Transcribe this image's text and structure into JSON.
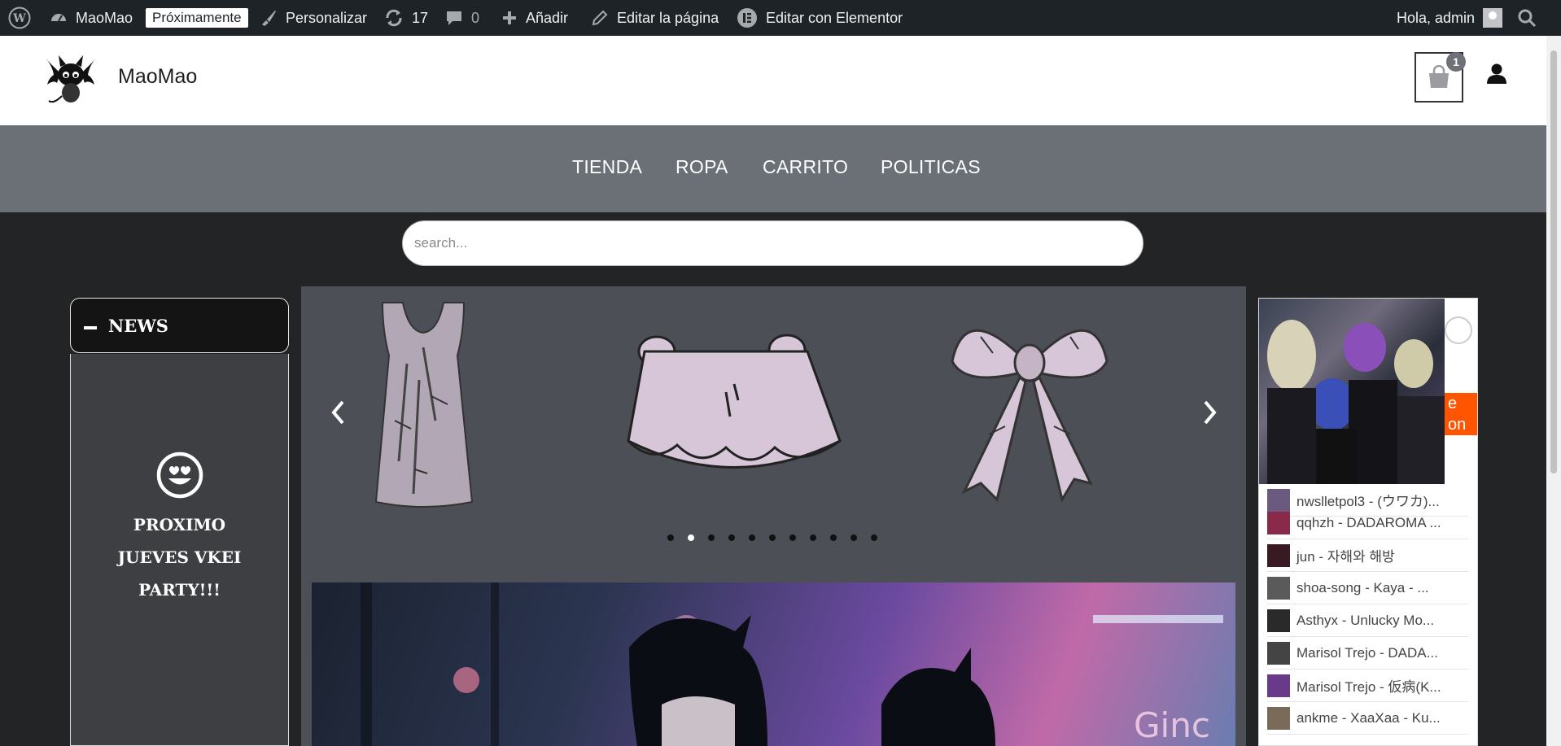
{
  "admin_bar": {
    "site_name": "MaoMao",
    "coming_soon": "Próximamente",
    "customize": "Personalizar",
    "updates_count": "17",
    "comments_count": "0",
    "add_new": "Añadir",
    "edit_page": "Editar la página",
    "edit_elementor": "Editar con Elementor",
    "greeting": "Hola, admin"
  },
  "header": {
    "site_title": "MaoMao",
    "cart_count": "1"
  },
  "nav": {
    "items": [
      "TIENDA",
      "ROPA",
      "CARRITO",
      "POLITICAS"
    ]
  },
  "search": {
    "placeholder": "search..."
  },
  "news": {
    "title": "NEWS",
    "body": "PROXIMO JUEVES VKEI PARTY!!!"
  },
  "carousel": {
    "slide_count": 11,
    "active_index": 1
  },
  "soundcloud": {
    "listen_text": "e on ud",
    "tracks": [
      "nwslletpol3 - (ウワカ)...",
      "qqhzh - DADAROMA ...",
      "jun - 자해와 해방",
      "shoa-song - Kaya - ...",
      "Asthyx - Unlucky Mo...",
      "Marisol Trejo - DADA...",
      "Marisol Trejo - 仮病(K...",
      "ankme - XaaXaa - Ku..."
    ]
  },
  "colors": {
    "admin_bg": "#1d2327",
    "nav_bg": "#6b6f76",
    "page_bg": "#222425",
    "slider_bg": "#4c4f55",
    "soundcloud": "#ff5500",
    "garment": "#d6c6d8"
  }
}
